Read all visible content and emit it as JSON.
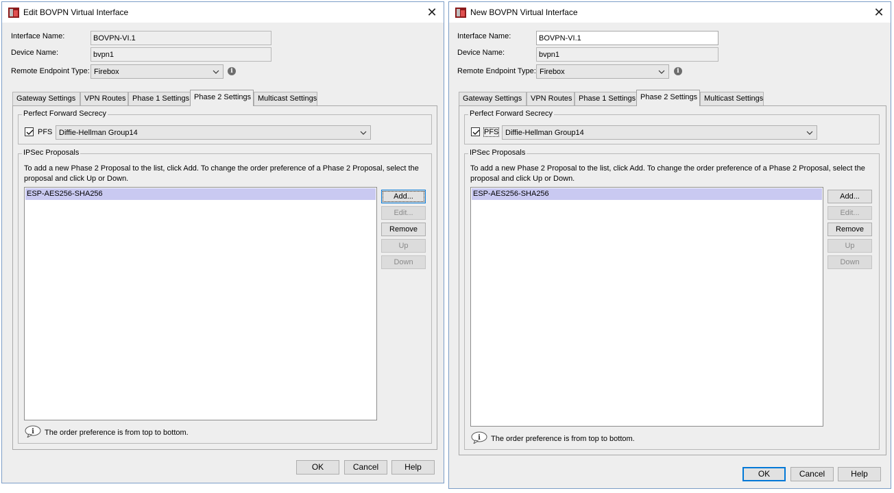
{
  "dialogs": [
    {
      "title": "Edit BOVPN Virtual Interface",
      "close_glyph": "✕",
      "interface_name_label": "Interface Name:",
      "interface_name_value": "BOVPN-VI.1",
      "device_name_label": "Device Name:",
      "device_name_value": "bvpn1",
      "remote_endpoint_label": "Remote Endpoint Type:",
      "remote_endpoint_value": "Firebox",
      "info_glyph": "i",
      "tabs": [
        "Gateway Settings",
        "VPN Routes",
        "Phase 1 Settings",
        "Phase 2 Settings",
        "Multicast Settings"
      ],
      "active_tab": "Phase 2 Settings",
      "pfs_group_title": "Perfect Forward Secrecy",
      "pfs_label": "PFS",
      "pfs_checked": true,
      "dh_group_value": "Diffie-Hellman Group14",
      "ipsec_group_title": "IPSec Proposals",
      "ipsec_desc_line1": "To add a new Phase 2 Proposal to the list, click Add. To change the order preference of a Phase 2 Proposal, select the",
      "ipsec_desc_line2": "proposal and click Up or Down.",
      "proposals": [
        "ESP-AES256-SHA256"
      ],
      "add_label": "Add...",
      "edit_label": "Edit...",
      "remove_label": "Remove",
      "up_label": "Up",
      "down_label": "Down",
      "order_note": "The order preference is from top to bottom.",
      "ok_label": "OK",
      "cancel_label": "Cancel",
      "help_label": "Help"
    },
    {
      "title": "New BOVPN Virtual Interface",
      "close_glyph": "✕",
      "interface_name_label": "Interface Name:",
      "interface_name_value": "BOVPN-VI.1",
      "device_name_label": "Device Name:",
      "device_name_value": "bvpn1",
      "remote_endpoint_label": "Remote Endpoint Type:",
      "remote_endpoint_value": "Firebox",
      "info_glyph": "i",
      "tabs": [
        "Gateway Settings",
        "VPN Routes",
        "Phase 1 Settings",
        "Phase 2 Settings",
        "Multicast Settings"
      ],
      "active_tab": "Phase 2 Settings",
      "pfs_group_title": "Perfect Forward Secrecy",
      "pfs_label": "PFS",
      "pfs_checked": true,
      "dh_group_value": "Diffie-Hellman Group14",
      "ipsec_group_title": "IPSec Proposals",
      "ipsec_desc_line1": "To add a new Phase 2 Proposal to the list, click Add. To change the order preference of a Phase 2 Proposal, select the",
      "ipsec_desc_line2": "proposal and click Up or Down.",
      "proposals": [
        "ESP-AES256-SHA256"
      ],
      "add_label": "Add...",
      "edit_label": "Edit...",
      "remove_label": "Remove",
      "up_label": "Up",
      "down_label": "Down",
      "order_note": "The order preference is from top to bottom.",
      "ok_label": "OK",
      "cancel_label": "Cancel",
      "help_label": "Help"
    }
  ],
  "colors": {
    "dialog_bg": "#eeeeee",
    "selection": "#c9c9f1",
    "focus_border": "#0078d7",
    "window_border": "#7a9cc6"
  }
}
